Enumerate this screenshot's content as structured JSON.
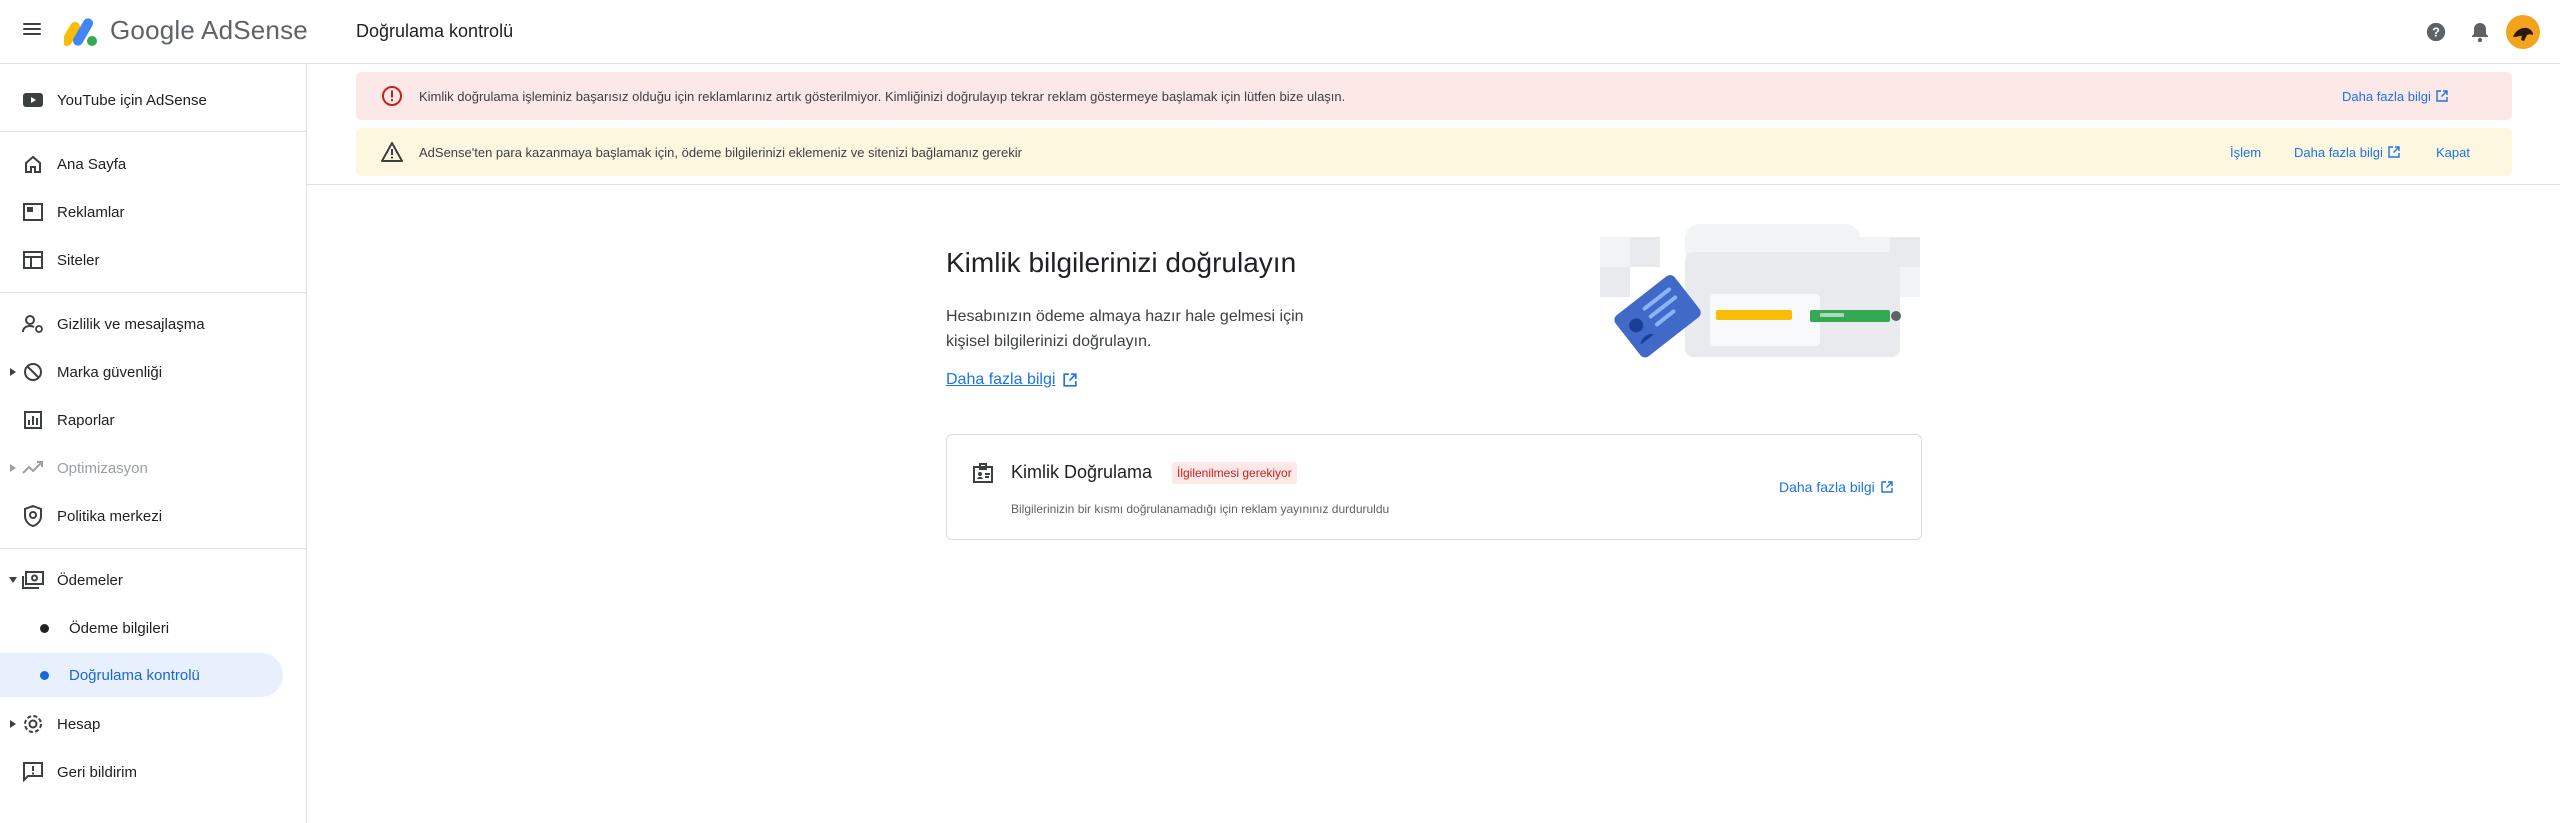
{
  "header": {
    "brand": "Google AdSense",
    "page_title": "Doğrulama kontrolü",
    "icons": [
      "menu-icon",
      "help-icon",
      "notifications-icon",
      "avatar"
    ]
  },
  "sidebar": {
    "items": [
      {
        "label": "YouTube için AdSense",
        "icon": "youtube-icon"
      },
      {
        "label": "Ana Sayfa",
        "icon": "home-icon"
      },
      {
        "label": "Reklamlar",
        "icon": "ads-icon"
      },
      {
        "label": "Siteler",
        "icon": "sites-icon"
      },
      {
        "label": "Gizlilik ve mesajlaşma",
        "icon": "privacy-icon"
      },
      {
        "label": "Marka güvenliği",
        "icon": "block-icon"
      },
      {
        "label": "Raporlar",
        "icon": "reports-icon"
      },
      {
        "label": "Optimizasyon",
        "icon": "trending-icon"
      },
      {
        "label": "Politika merkezi",
        "icon": "policy-icon"
      },
      {
        "label": "Ödemeler",
        "icon": "payments-icon"
      },
      {
        "label": "Ödeme bilgileri"
      },
      {
        "label": "Doğrulama kontrolü"
      },
      {
        "label": "Hesap",
        "icon": "gear-icon"
      },
      {
        "label": "Geri bildirim",
        "icon": "feedback-icon"
      }
    ]
  },
  "banners": {
    "error": {
      "text": "Kimlik doğrulama işleminiz başarısız olduğu için reklamlarınız artık gösterilmiyor. Kimliğinizi doğrulayıp tekrar reklam göstermeye başlamak için lütfen bize ulaşın.",
      "link": "Daha fazla bilgi"
    },
    "warn": {
      "text": "AdSense'ten para kazanmaya başlamak için, ödeme bilgilerinizi eklemeniz ve sitenizi bağlamanız gerekir",
      "action": "İşlem",
      "link": "Daha fazla bilgi",
      "dismiss": "Kapat"
    }
  },
  "main": {
    "title": "Kimlik bilgilerinizi doğrulayın",
    "description": "Hesabınızın ödeme almaya hazır hale gelmesi için kişisel bilgilerinizi doğrulayın.",
    "link": "Daha fazla bilgi",
    "card": {
      "title": "Kimlik Doğrulama",
      "badge": "İlgilenilmesi gerekiyor",
      "subtitle": "Bilgilerinizin bir kısmı doğrulanamadığı için reklam yayınınız durduruldu",
      "link": "Daha fazla bilgi"
    }
  },
  "colors": {
    "accent": "#1a73e8",
    "error_bg": "#fce8e6",
    "warn_bg": "#fef7e0",
    "badge_text": "#c5221f"
  }
}
